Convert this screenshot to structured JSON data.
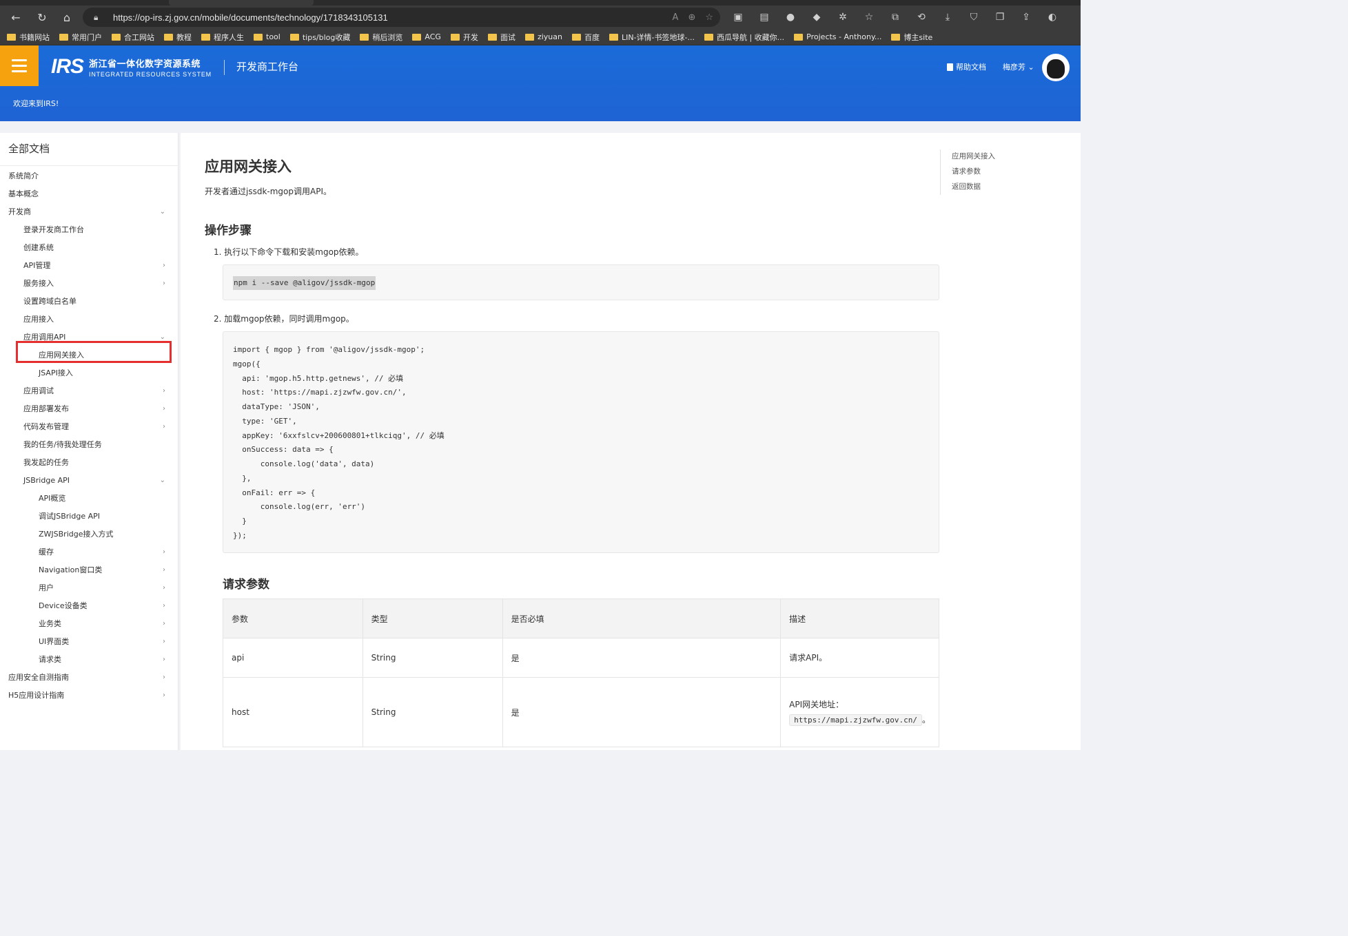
{
  "browser": {
    "url": "https://op-irs.zj.gov.cn/mobile/documents/technology/1718343105131",
    "bookmarks": [
      "书籍网站",
      "常用门户",
      "合工网站",
      "教程",
      "程序人生",
      "tool",
      "tips/blog收藏",
      "稍后浏览",
      "ACG",
      "开发",
      "面试",
      "ziyuan",
      "百度",
      "LIN-详情-书签地球-...",
      "西瓜导航 | 收藏你...",
      "Projects - Anthony...",
      "博主site"
    ]
  },
  "header": {
    "logo_text": "IRS",
    "system_name_cn": "浙江省一体化数字资源系统",
    "system_name_en": "INTEGRATED RESOURCES SYSTEM",
    "workbench": "开发商工作台",
    "help_label": "帮助文档",
    "user_name": "梅彦芳",
    "welcome": "欢迎来到IRS!"
  },
  "sidebar": {
    "title": "全部文档",
    "items": [
      {
        "label": "系统简介",
        "level": 0,
        "chev": ""
      },
      {
        "label": "基本概念",
        "level": 0,
        "chev": ""
      },
      {
        "label": "开发商",
        "level": 0,
        "chev": "down"
      },
      {
        "label": "登录开发商工作台",
        "level": 1,
        "chev": ""
      },
      {
        "label": "创建系统",
        "level": 1,
        "chev": ""
      },
      {
        "label": "API管理",
        "level": 1,
        "chev": "right"
      },
      {
        "label": "服务接入",
        "level": 1,
        "chev": "right"
      },
      {
        "label": "设置跨域白名单",
        "level": 1,
        "chev": ""
      },
      {
        "label": "应用接入",
        "level": 1,
        "chev": ""
      },
      {
        "label": "应用调用API",
        "level": 1,
        "chev": "down"
      },
      {
        "label": "应用网关接入",
        "level": 2,
        "chev": "",
        "active": true
      },
      {
        "label": "JSAPI接入",
        "level": 2,
        "chev": ""
      },
      {
        "label": "应用调试",
        "level": 1,
        "chev": "right"
      },
      {
        "label": "应用部署发布",
        "level": 1,
        "chev": "right"
      },
      {
        "label": "代码发布管理",
        "level": 1,
        "chev": "right"
      },
      {
        "label": "我的任务/待我处理任务",
        "level": 1,
        "chev": ""
      },
      {
        "label": "我发起的任务",
        "level": 1,
        "chev": ""
      },
      {
        "label": "JSBridge API",
        "level": 1,
        "chev": "down"
      },
      {
        "label": "API概览",
        "level": 2,
        "chev": ""
      },
      {
        "label": "调试JSBridge API",
        "level": 2,
        "chev": ""
      },
      {
        "label": "ZWJSBridge接入方式",
        "level": 2,
        "chev": ""
      },
      {
        "label": "缓存",
        "level": 2,
        "chev": "right"
      },
      {
        "label": "Navigation窗口类",
        "level": 2,
        "chev": "right"
      },
      {
        "label": "用户",
        "level": 2,
        "chev": "right"
      },
      {
        "label": "Device设备类",
        "level": 2,
        "chev": "right"
      },
      {
        "label": "业务类",
        "level": 2,
        "chev": "right"
      },
      {
        "label": "UI界面类",
        "level": 2,
        "chev": "right"
      },
      {
        "label": "请求类",
        "level": 2,
        "chev": "right"
      },
      {
        "label": "应用安全自测指南",
        "level": 0,
        "chev": "right"
      },
      {
        "label": "H5应用设计指南",
        "level": 0,
        "chev": "right"
      }
    ]
  },
  "content": {
    "title": "应用网关接入",
    "intro": "开发者通过jssdk-mgop调用API。",
    "steps_title": "操作步骤",
    "step1": "1. 执行以下命令下载和安装mgop依赖。",
    "code1": "npm i --save @aligov/jssdk-mgop",
    "step2": "2. 加载mgop依赖，同时调用mgop。",
    "code2": [
      "import { mgop } from '@aligov/jssdk-mgop';",
      "mgop({",
      "  api: 'mgop.h5.http.getnews', // 必填",
      "  host: 'https://mapi.zjzwfw.gov.cn/',",
      "  dataType: 'JSON',",
      "  type: 'GET',",
      "  appKey: '6xxfslcv+200600801+tlkciqg', // 必填",
      "  onSuccess: data => {",
      "      console.log('data', data)",
      "  },",
      "  onFail: err => {",
      "      console.log(err, 'err')",
      "  }",
      "});"
    ],
    "params_title": "请求参数",
    "table": {
      "headers": [
        "参数",
        "类型",
        "是否必填",
        "描述"
      ],
      "rows": [
        {
          "param": "api",
          "type": "String",
          "required": "是",
          "desc": "请求API。"
        },
        {
          "param": "host",
          "type": "String",
          "required": "是",
          "desc_prefix": "API网关地址：",
          "desc_code": "https://mapi.zjzwfw.gov.cn/",
          "desc_suffix": "。"
        }
      ]
    }
  },
  "toc": [
    "应用网关接入",
    "请求参数",
    "返回数据"
  ],
  "colors": {
    "header_blue": "#1a6bd9",
    "menu_orange": "#f6a10e",
    "highlight_red": "#e52e2e"
  }
}
